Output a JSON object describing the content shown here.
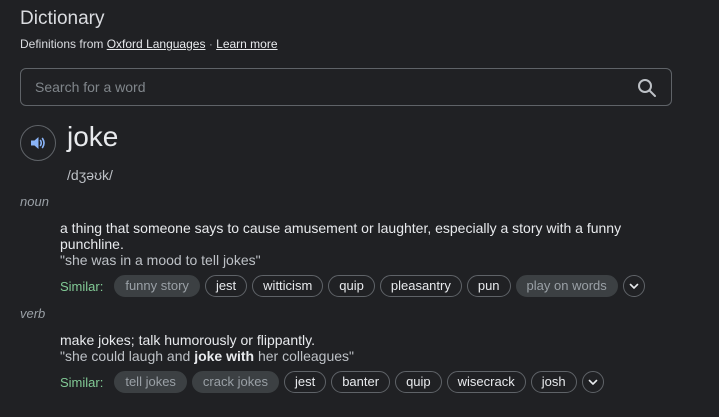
{
  "header": {
    "title": "Dictionary",
    "source_prefix": "Definitions from",
    "source_link": "Oxford Languages",
    "separator": "·",
    "learn_more": "Learn more"
  },
  "search": {
    "placeholder": "Search for a word",
    "icon": "search-icon"
  },
  "entry": {
    "word": "joke",
    "phonetic": "/dʒəʊk/",
    "audio_icon": "speaker-icon",
    "senses": [
      {
        "pos": "noun",
        "definition": "a thing that someone says to cause amusement or laughter, especially a story with a funny punchline.",
        "example": "\"she was in a mood to tell jokes\"",
        "similar_label": "Similar:",
        "similar": [
          "funny story",
          "jest",
          "witticism",
          "quip",
          "pleasantry",
          "pun",
          "play on words"
        ]
      },
      {
        "pos": "verb",
        "definition": "make jokes; talk humorously or flippantly.",
        "example_before": "\"she could laugh and ",
        "example_bold": "joke with",
        "example_after": " her colleagues\"",
        "similar_label": "Similar:",
        "similar": [
          "tell jokes",
          "crack jokes",
          "jest",
          "banter",
          "quip",
          "wisecrack",
          "josh"
        ]
      }
    ]
  },
  "colors": {
    "background": "#202124",
    "similar_label": "#81c995",
    "chip_border": "#5f6368",
    "chip_dim_bg": "#3c4043"
  }
}
